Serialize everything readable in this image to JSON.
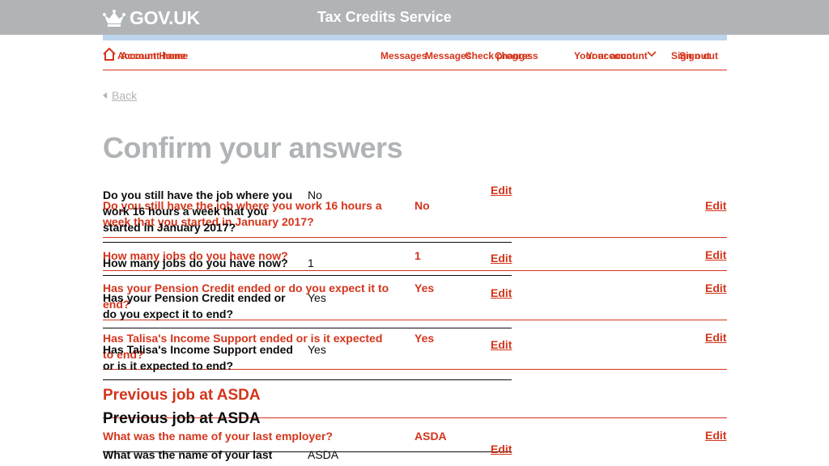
{
  "header": {
    "logo_text": "GOV.UK",
    "service_name": "Tax Credits Service"
  },
  "nav": {
    "home_a": "Account Home",
    "home_b": "Account home",
    "messages_a": "Messages",
    "messages_b": "Messages",
    "check_a": "Check progress",
    "check_b": "Change",
    "account_a": "Your account",
    "account_b": "Your account",
    "signout_a": "Sign out",
    "signout_b": "Sign out"
  },
  "back_label": "Back",
  "page_title": "Confirm your answers",
  "answers_a": [
    {
      "question": "Do you still have the job where you work 16 hours a week that you started in January 2017?",
      "answer": "No",
      "edit": "Edit"
    },
    {
      "question": "How many jobs do you have now?",
      "answer": "1",
      "edit": "Edit"
    },
    {
      "question": "Has your Pension Credit ended or do you expect it to end?",
      "answer": "Yes",
      "edit": "Edit"
    },
    {
      "question": "Has Talisa's Income Support ended or is it expected to end?",
      "answer": "Yes",
      "edit": "Edit"
    }
  ],
  "answers_b": [
    {
      "question": "Do you still have the job where you work 16 hours a week that you started in January 2017?",
      "answer": "No",
      "edit": "Edit"
    },
    {
      "question": "How many jobs do you have now?",
      "answer": "1",
      "edit": "Edit"
    },
    {
      "question": "Has your Pension Credit ended or do you expect it to end?",
      "answer": "Yes",
      "edit": "Edit"
    },
    {
      "question": "Has Talisa's Income Support ended or is it expected to end?",
      "answer": "Yes",
      "edit": "Edit"
    }
  ],
  "section_a": {
    "title": "Previous job at ASDA",
    "question": "What was the name of your last employer?",
    "answer": "ASDA",
    "edit": "Edit"
  },
  "section_b": {
    "title": "Previous job at ASDA",
    "question": "What was the name of your last employer?",
    "answer": "ASDA",
    "edit": "Edit"
  },
  "colors": {
    "link_red": "#d4351c",
    "header_grey": "#b1b4b6",
    "stripe_blue": "#bcd5ea",
    "text": "#0b0c0c"
  },
  "icons": [
    "crown-icon",
    "home-icon",
    "chevron-down-icon",
    "back-triangle-icon"
  ]
}
